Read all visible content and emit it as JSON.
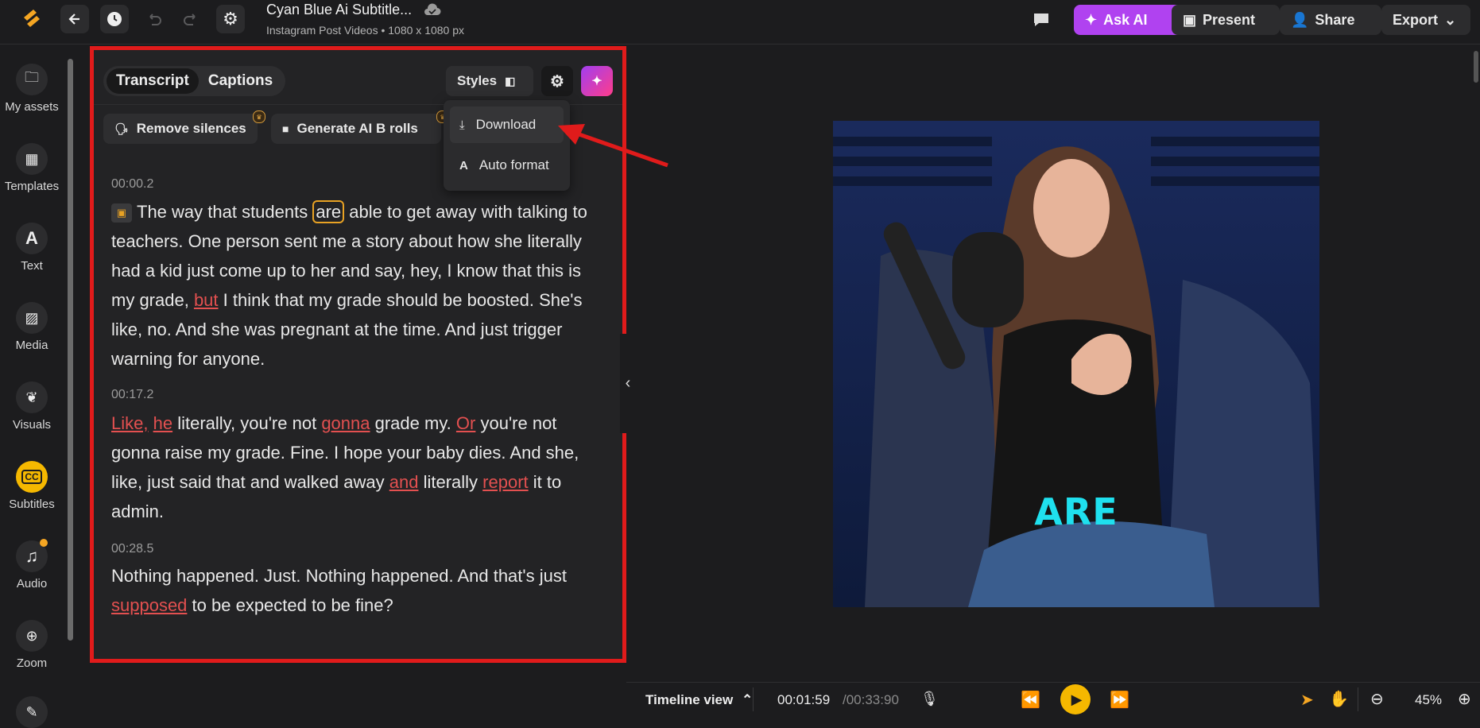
{
  "header": {
    "title": "Cyan Blue Ai Subtitle...",
    "subtitle": "Instagram Post Videos • 1080 x 1080 px",
    "ask_ai": "Ask AI",
    "present": "Present",
    "share": "Share",
    "export": "Export"
  },
  "sidebar": {
    "items": [
      {
        "label": "My assets"
      },
      {
        "label": "Templates"
      },
      {
        "label": "Text"
      },
      {
        "label": "Media"
      },
      {
        "label": "Visuals"
      },
      {
        "label": "Subtitles"
      },
      {
        "label": "Audio"
      },
      {
        "label": "Zoom"
      }
    ]
  },
  "panel": {
    "tabs": [
      "Transcript",
      "Captions"
    ],
    "styles_label": "Styles",
    "remove_silences": "Remove silences",
    "generate_broll": "Generate AI B rolls",
    "dropdown": [
      "Download",
      "Auto format"
    ],
    "segments": [
      {
        "time": "00:00.2"
      },
      {
        "time": "00:17.2"
      },
      {
        "time": "00:28.5"
      }
    ]
  },
  "preview": {
    "caption_word": "ARE"
  },
  "timeline": {
    "view_label": "Timeline view",
    "current_time": "00:01:59",
    "total_time": "/00:33:90",
    "zoom": "45%"
  },
  "colors": {
    "accent": "#e8a224",
    "ask_ai": "#b042f0",
    "highlight_border": "#e01b1b",
    "flagged_word": "#e35050",
    "caption": "#1fe0ee"
  }
}
